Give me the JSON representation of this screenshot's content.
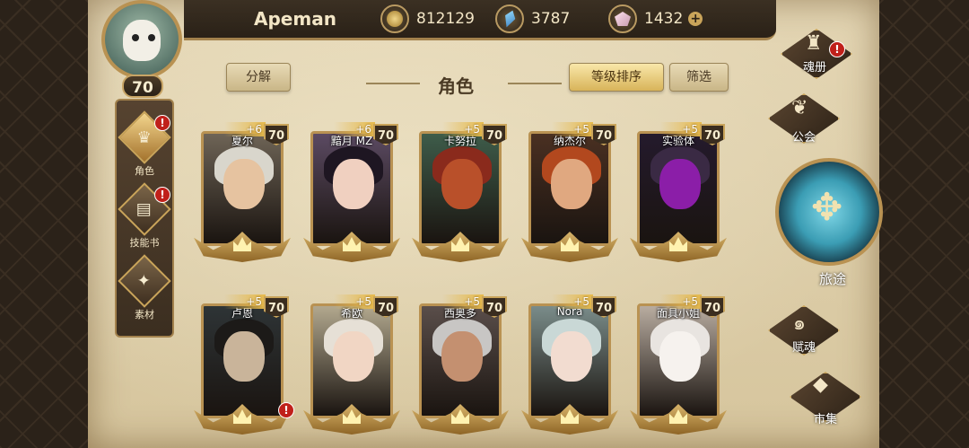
{
  "player": {
    "name": "Apeman",
    "level": "70"
  },
  "currencies": [
    {
      "icon": "gold-coin-icon",
      "value": "812129"
    },
    {
      "icon": "blue-crystal-icon",
      "value": "3787"
    },
    {
      "icon": "pink-gem-icon",
      "value": "1432",
      "plus": "+"
    }
  ],
  "header": {
    "title": "角色",
    "decompose": "分解",
    "sort": "等级排序",
    "filter": "筛选"
  },
  "leftnav": [
    {
      "label": "角色",
      "icon": "character-icon",
      "active": true,
      "alert": "!"
    },
    {
      "label": "技能书",
      "icon": "skill-book-icon",
      "active": false,
      "alert": "!"
    },
    {
      "label": "素材",
      "icon": "material-icon",
      "active": false
    }
  ],
  "heroes": [
    {
      "name": "夏尔",
      "level": "70",
      "plus": "+6",
      "hair": "#d9d6cc",
      "skin": "#e6c3a0",
      "bg": "#6e6456"
    },
    {
      "name": "黯月 MZ",
      "level": "70",
      "plus": "+6",
      "hair": "#1e1622",
      "skin": "#f0d0c0",
      "bg": "#5b4a62"
    },
    {
      "name": "卡努拉",
      "level": "70",
      "plus": "+5",
      "hair": "#8a2a1c",
      "skin": "#b9502a",
      "bg": "#3e5c4a"
    },
    {
      "name": "纳杰尔",
      "level": "70",
      "plus": "+5",
      "hair": "#b2481e",
      "skin": "#e0a880",
      "bg": "#4a3022"
    },
    {
      "name": "实验体",
      "level": "70",
      "plus": "+5",
      "hair": "#3a2a44",
      "skin": "#8b1ea8",
      "bg": "#241a2c"
    },
    {
      "name": "卢恩",
      "level": "70",
      "plus": "+5",
      "hair": "#1c1a18",
      "skin": "#c9b49a",
      "bg": "#2e3436",
      "alert": "!"
    },
    {
      "name": "希欧",
      "level": "70",
      "plus": "+5",
      "hair": "#e6e0d6",
      "skin": "#f1d6c4",
      "bg": "#b2a88e"
    },
    {
      "name": "西奥多",
      "level": "70",
      "plus": "+5",
      "hair": "#c8c6c4",
      "skin": "#c49070",
      "bg": "#5a4e4a"
    },
    {
      "name": "Nora",
      "level": "70",
      "plus": "+5",
      "hair": "#c9d8d6",
      "skin": "#f2dcd0",
      "bg": "#7a8c8a"
    },
    {
      "name": "面具小姐",
      "level": "70",
      "plus": "+5",
      "hair": "#e8e4e0",
      "skin": "#f6f2ee",
      "bg": "#b8aca0"
    }
  ],
  "rightnav": [
    {
      "label": "魂册",
      "icon": "soul-book-icon",
      "alert": "!"
    },
    {
      "label": "公会",
      "icon": "guild-icon"
    },
    {
      "label": "旅途",
      "icon": "journey-icon"
    },
    {
      "label": "赋魂",
      "icon": "soul-infuse-icon"
    },
    {
      "label": "市集",
      "icon": "market-icon"
    }
  ]
}
